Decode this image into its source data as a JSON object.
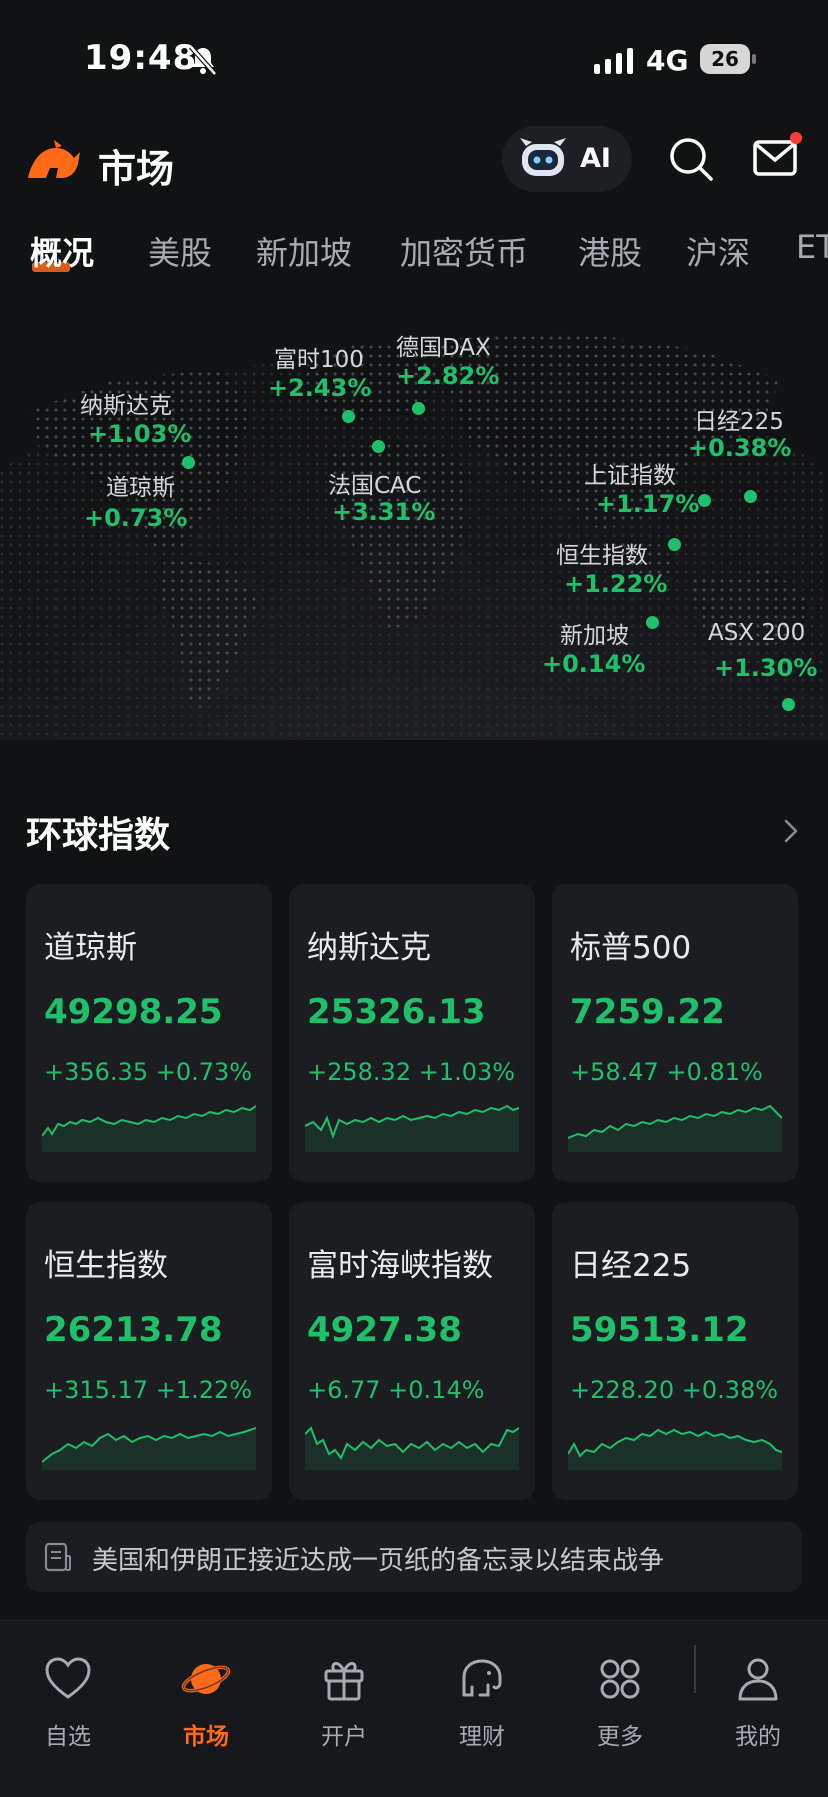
{
  "status_bar": {
    "time": "19:48",
    "network": "4G",
    "battery": "26"
  },
  "header": {
    "title": "市场",
    "ai_label": "AI"
  },
  "tabs": [
    "概况",
    "美股",
    "新加坡",
    "加密货币",
    "港股",
    "沪深",
    "ET"
  ],
  "map_markers": [
    {
      "name": "纳斯达克",
      "change": "+1.03%"
    },
    {
      "name": "道琼斯",
      "change": "+0.73%"
    },
    {
      "name": "富时100",
      "change": "+2.43%"
    },
    {
      "name": "德国DAX",
      "change": "+2.82%"
    },
    {
      "name": "法国CAC",
      "change": "+3.31%"
    },
    {
      "name": "日经225",
      "change": "+0.38%"
    },
    {
      "name": "上证指数",
      "change": "+1.17%"
    },
    {
      "name": "恒生指数",
      "change": "+1.22%"
    },
    {
      "name": "新加坡",
      "change": "+0.14%"
    },
    {
      "name": "ASX 200",
      "change": "+1.30%"
    }
  ],
  "section": {
    "title": "环球指数"
  },
  "index_cards": [
    {
      "name": "道琼斯",
      "price": "49298.25",
      "change": "+356.35 +0.73%"
    },
    {
      "name": "纳斯达克",
      "price": "25326.13",
      "change": "+258.32 +1.03%"
    },
    {
      "name": "标普500",
      "price": "7259.22",
      "change": "+58.47 +0.81%"
    },
    {
      "name": "恒生指数",
      "price": "26213.78",
      "change": "+315.17 +1.22%"
    },
    {
      "name": "富时海峡指数",
      "price": "4927.38",
      "change": "+6.77 +0.14%"
    },
    {
      "name": "日经225",
      "price": "59513.12",
      "change": "+228.20 +0.38%"
    }
  ],
  "news": {
    "headline": "美国和伊朗正接近达成一页纸的备忘录以结束战争"
  },
  "bottom_nav": [
    {
      "label": "自选",
      "icon": "heart-icon"
    },
    {
      "label": "市场",
      "icon": "planet-icon",
      "active": true
    },
    {
      "label": "开户",
      "icon": "gift-icon"
    },
    {
      "label": "理财",
      "icon": "elephant-icon"
    },
    {
      "label": "更多",
      "icon": "grid-icon"
    },
    {
      "label": "我的",
      "icon": "user-icon"
    }
  ],
  "colors": {
    "up_green": "#1fc06b",
    "accent_orange": "#ff6a18",
    "background": "#111214",
    "card": "#1c1d21"
  }
}
